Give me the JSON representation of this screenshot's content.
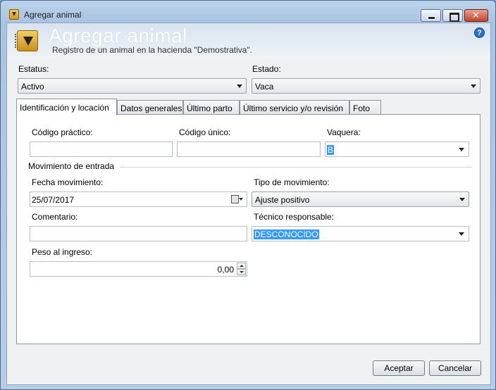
{
  "window": {
    "title": "Agregar animal"
  },
  "header": {
    "title": "Agregar animal",
    "subtitle": "Registro de un animal en la hacienda \"Demostrativa\".",
    "help_glyph": "?"
  },
  "top_fields": {
    "estatus_label": "Estatus:",
    "estatus_value": "Activo",
    "estado_label": "Estado:",
    "estado_value": "Vaca"
  },
  "tabs": [
    {
      "label": "Identificación y locación",
      "active": true
    },
    {
      "label": "Datos generales",
      "active": false
    },
    {
      "label": "Último parto",
      "active": false
    },
    {
      "label": "Último servicio y/o revisión",
      "active": false
    },
    {
      "label": "Foto",
      "active": false
    }
  ],
  "form": {
    "codigo_practico_label": "Código práctico:",
    "codigo_practico_value": "",
    "codigo_unico_label": "Código único:",
    "codigo_unico_value": "",
    "vaquera_label": "Vaquera:",
    "vaquera_value": "B",
    "section_movimiento": "Movimiento de entrada",
    "fecha_label": "Fecha movimiento:",
    "fecha_value": "25/07/2017",
    "tipo_label": "Tipo de movimiento:",
    "tipo_value": "Ajuste positivo",
    "comentario_label": "Comentario:",
    "comentario_value": "",
    "tecnico_label": "Técnico responsable:",
    "tecnico_value": "DESCONOCIDO",
    "peso_label": "Peso al ingreso:",
    "peso_value": "0,00"
  },
  "buttons": {
    "accept": "Aceptar",
    "cancel": "Cancelar"
  },
  "colors": {
    "selection": "#3399ff",
    "title_band": "#bcd3ea"
  }
}
